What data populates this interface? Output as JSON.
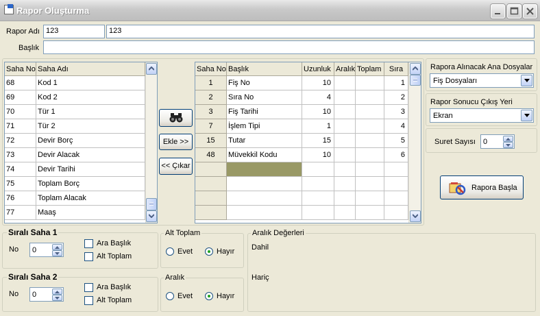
{
  "window": {
    "title": "Rapor Oluşturma"
  },
  "form": {
    "rapor_adi_label": "Rapor Adı",
    "rapor_adi_code": "123",
    "rapor_adi_name": "123",
    "baslik_label": "Başlık",
    "baslik_value": ""
  },
  "left_grid": {
    "headers": [
      "Saha No",
      "Saha Adı"
    ],
    "rows": [
      [
        "68",
        "Kod 1"
      ],
      [
        "69",
        "Kod 2"
      ],
      [
        "70",
        "Tür 1"
      ],
      [
        "71",
        "Tür 2"
      ],
      [
        "72",
        "Devir Borç"
      ],
      [
        "73",
        "Devir Alacak"
      ],
      [
        "74",
        "Devir Tarihi"
      ],
      [
        "75",
        "Toplam Borç"
      ],
      [
        "76",
        "Toplam Alacak"
      ],
      [
        "77",
        "Maaş"
      ]
    ]
  },
  "buttons": {
    "find_icon": "binoculars-icon",
    "ekle": "Ekle >>",
    "cikar": "<< Çıkar",
    "rapor_basla": "Rapora Başla"
  },
  "right_grid": {
    "headers": [
      "Saha No",
      "Başlık",
      "Uzunluk",
      "Aralık",
      "Toplam",
      "Sıra"
    ],
    "rows": [
      [
        "1",
        "Fiş No",
        "10",
        "",
        "",
        "1"
      ],
      [
        "2",
        "Sıra No",
        "4",
        "",
        "",
        "2"
      ],
      [
        "3",
        "Fiş Tarihi",
        "10",
        "",
        "",
        "3"
      ],
      [
        "7",
        "İşlem Tipi",
        "1",
        "",
        "",
        "4"
      ],
      [
        "15",
        "Tutar",
        "15",
        "",
        "",
        "5"
      ],
      [
        "48",
        "Müvekkil Kodu",
        "10",
        "",
        "",
        "6"
      ]
    ],
    "selected_row_color": "#999966"
  },
  "side": {
    "ana_dosya_label": "Rapora Alınacak Ana Dosyalar",
    "ana_dosya_value": "Fiş Dosyaları",
    "cikis_label": "Rapor Sonucu Çıkış Yeri",
    "cikis_value": "Ekran",
    "suret_label": "Suret  Sayısı",
    "suret_value": "0"
  },
  "sirali1": {
    "title": "Sıralı Saha 1",
    "no_label": "No",
    "no_value": "0",
    "ara_baslik": "Ara Başlık",
    "alt_toplam": "Alt Toplam"
  },
  "sirali2": {
    "title": "Sıralı Saha 2",
    "no_label": "No",
    "no_value": "0",
    "ara_baslik": "Ara Başlık",
    "alt_toplam": "Alt Toplam"
  },
  "alt_toplam_group": {
    "title": "Alt Toplam",
    "evet": "Evet",
    "hayir": "Hayır",
    "selected": "Hayır"
  },
  "aralik_group": {
    "title": "Aralık",
    "evet": "Evet",
    "hayir": "Hayır",
    "selected": "Hayır"
  },
  "aralik_degerleri": {
    "title": "Aralık Değerleri",
    "dahil": "Dahil",
    "haric": "Hariç"
  }
}
